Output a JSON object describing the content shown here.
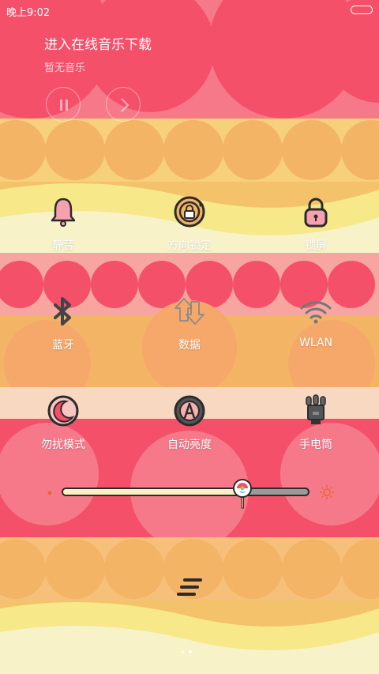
{
  "status_bar": {
    "time": "晚上9:02"
  },
  "music": {
    "title": "进入在线音乐下载",
    "subtitle": "暂无音乐"
  },
  "toggles": [
    {
      "label": "静音",
      "icon": "bell-icon"
    },
    {
      "label": "方向锁定",
      "icon": "rotation-lock-icon"
    },
    {
      "label": "锁屏",
      "icon": "padlock-icon"
    },
    {
      "label": "蓝牙",
      "icon": "bluetooth-icon"
    },
    {
      "label": "数据",
      "icon": "data-arrows-icon"
    },
    {
      "label": "WLAN",
      "icon": "wifi-icon"
    },
    {
      "label": "勿扰模式",
      "icon": "moon-icon"
    },
    {
      "label": "自动亮度",
      "icon": "auto-brightness-icon"
    },
    {
      "label": "手电筒",
      "icon": "flashlight-icon"
    }
  ],
  "brightness": {
    "level": 0.73
  },
  "colors": {
    "red": "#f4506a",
    "orange": "#f3b466",
    "yellow": "#f7e88a",
    "cream": "#f7edc2"
  }
}
